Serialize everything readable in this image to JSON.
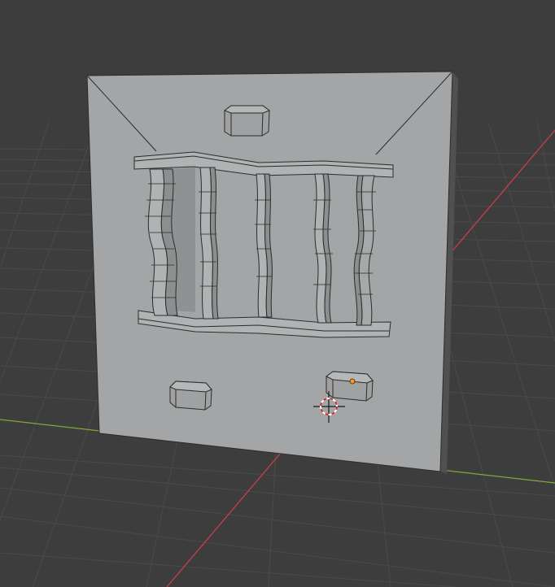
{
  "viewport": {
    "background": "#3d3d3d",
    "grid_color": "#4a4a4a",
    "x_axis_color": "#c8404a",
    "y_axis_color": "#7fa83a"
  },
  "scene": {
    "panel_face_color": "#a3a5a6",
    "panel_side_color": "#505050",
    "edge_color": "#2c2c2c",
    "origin_dot_color": "#ff9a1c",
    "cursor_colors": [
      "#ffffff",
      "#d42a2a"
    ]
  }
}
